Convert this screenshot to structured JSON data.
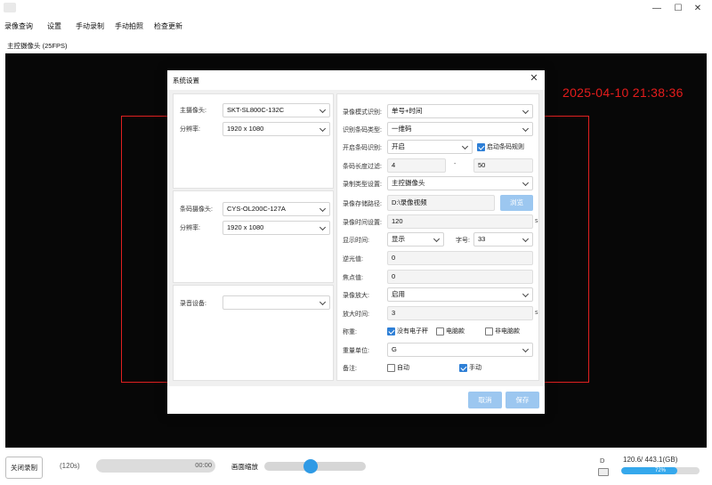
{
  "window": {
    "icons": {
      "app": "app-icon",
      "minimize": "minimize-icon",
      "maximize": "maximize-icon",
      "close": "close-icon"
    },
    "minimize_glyph": "—",
    "maximize_glyph": "☐",
    "close_glyph": "✕"
  },
  "menu": [
    "录像查询",
    "设置",
    "手动录制",
    "手动拍照",
    "检查更新"
  ],
  "view_label": "主控摄像头    (25FPS)",
  "preview": {
    "timestamp": "2025-04-10 21:38:36",
    "overlay_color": "#e02020"
  },
  "dialog": {
    "title": "系统设置",
    "close_glyph": "✕",
    "main_camera": {
      "label": "主摄像头:",
      "value": "SKT-SL800C-132C",
      "res_label": "分辨率:",
      "res_value": "1920 x 1080"
    },
    "barcode_camera": {
      "label": "条码摄像头:",
      "value": "CYS-OL200C-127A",
      "res_label": "分辨率:",
      "res_value": "1920 x 1080"
    },
    "audio": {
      "label": "录音设备:",
      "value": ""
    },
    "record": {
      "mode_label": "录像模式识别:",
      "mode_value": "单号+时间",
      "barcode_type_label": "识别条码类型:",
      "barcode_type_value": "一维码",
      "barcode_recog_label": "开启条码识别:",
      "barcode_recog_value": "开启",
      "barcode_rule_label": "启动条码规则",
      "barcode_rule_checked": true,
      "length_label": "条码长度过滤:",
      "length_min": "4",
      "length_sep": "-",
      "length_max": "50",
      "rec_type_label": "录制类型设置:",
      "rec_type_value": "主控摄像头",
      "path_label": "录像存储路径:",
      "path_value": "D:\\录像视频",
      "browse_label": "浏览",
      "rec_time_label": "录像时间设置:",
      "rec_time_value": "120",
      "rec_time_unit": "s",
      "display_time_label": "显示时间:",
      "display_time_value": "显示",
      "font_size_label": "字号:",
      "font_size_value": "33",
      "backlight_label": "逆光值:",
      "backlight_value": "0",
      "focus_label": "焦点值:",
      "focus_value": "0",
      "zoom_label": "录像放大:",
      "zoom_value": "启用",
      "zoom_time_label": "放大时间:",
      "zoom_time_value": "3",
      "zoom_time_unit": "s",
      "weigh_label": "称重:",
      "weigh_options": [
        {
          "label": "没有电子秤",
          "checked": true
        },
        {
          "label": "电脑款",
          "checked": false
        },
        {
          "label": "非电脑款",
          "checked": false
        }
      ],
      "weight_unit_label": "重量单位:",
      "weight_unit_value": "G",
      "note_label": "备注:",
      "note_options": [
        {
          "label": "自动",
          "checked": false
        },
        {
          "label": "手动",
          "checked": true
        }
      ]
    },
    "cancel_label": "取消",
    "save_label": "保存"
  },
  "bottom": {
    "stop_label": "关闭录制",
    "duration": "(120s)",
    "progress_time": "00:00",
    "zoom_label": "画面缩放",
    "zoom_level": 0.45,
    "drive_letter": "D",
    "disk_text": "120.6/ 443.1(GB)",
    "disk_percent_label": "72%",
    "disk_percent": 0.72,
    "accent_color": "#35a8ec"
  }
}
